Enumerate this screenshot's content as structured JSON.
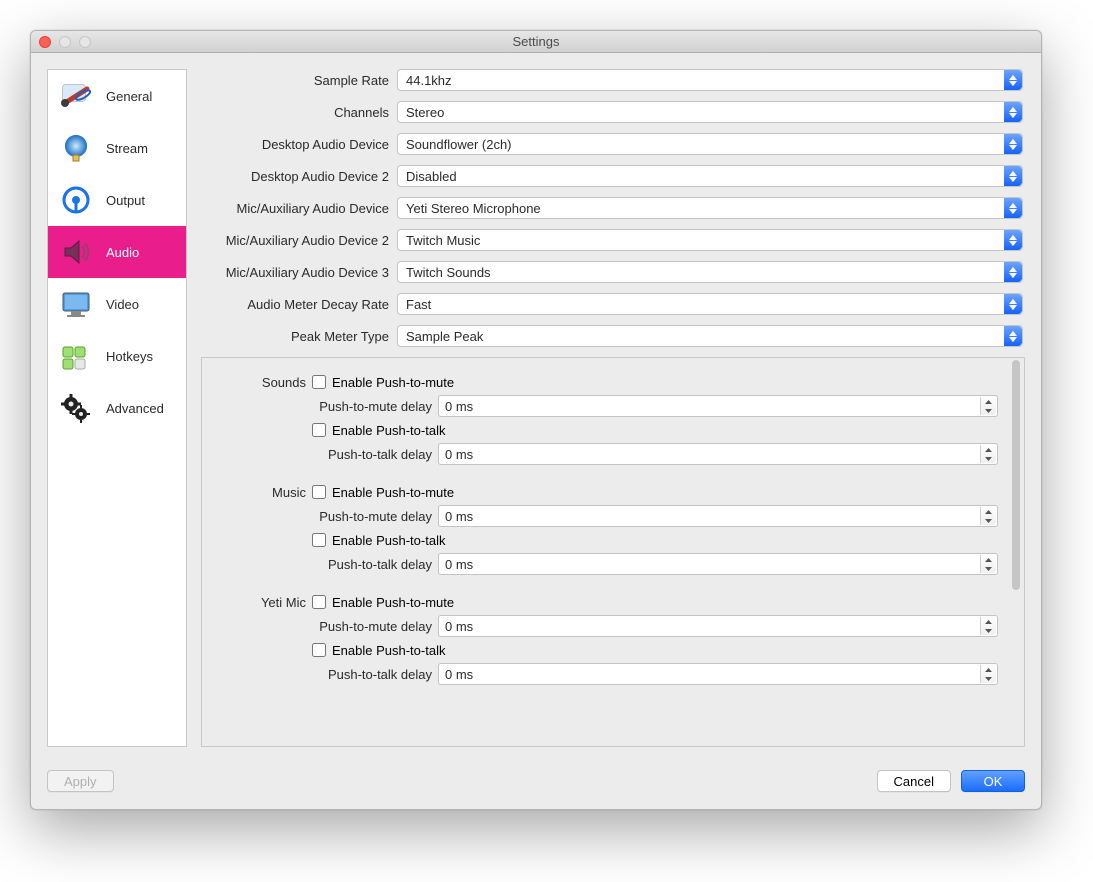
{
  "window": {
    "title": "Settings"
  },
  "sidebar": {
    "items": [
      {
        "label": "General"
      },
      {
        "label": "Stream"
      },
      {
        "label": "Output"
      },
      {
        "label": "Audio"
      },
      {
        "label": "Video"
      },
      {
        "label": "Hotkeys"
      },
      {
        "label": "Advanced"
      }
    ]
  },
  "fields": {
    "sample_rate": {
      "label": "Sample Rate",
      "value": "44.1khz"
    },
    "channels": {
      "label": "Channels",
      "value": "Stereo"
    },
    "desktop1": {
      "label": "Desktop Audio Device",
      "value": "Soundflower (2ch)"
    },
    "desktop2": {
      "label": "Desktop Audio Device 2",
      "value": "Disabled"
    },
    "mic1": {
      "label": "Mic/Auxiliary Audio Device",
      "value": "Yeti Stereo Microphone"
    },
    "mic2": {
      "label": "Mic/Auxiliary Audio Device 2",
      "value": "Twitch Music"
    },
    "mic3": {
      "label": "Mic/Auxiliary Audio Device 3",
      "value": "Twitch Sounds"
    },
    "decay": {
      "label": "Audio Meter Decay Rate",
      "value": "Fast"
    },
    "peak": {
      "label": "Peak Meter Type",
      "value": "Sample Peak"
    }
  },
  "sub_labels": {
    "enable_ptm": "Enable Push-to-mute",
    "enable_ptt": "Enable Push-to-talk",
    "ptm_delay": "Push-to-mute delay",
    "ptt_delay": "Push-to-talk delay"
  },
  "devices": [
    {
      "name": "Sounds",
      "ptm_delay": "0 ms",
      "ptt_delay": "0 ms"
    },
    {
      "name": "Music",
      "ptm_delay": "0 ms",
      "ptt_delay": "0 ms"
    },
    {
      "name": "Yeti Mic",
      "ptm_delay": "0 ms",
      "ptt_delay": "0 ms"
    }
  ],
  "buttons": {
    "apply": "Apply",
    "cancel": "Cancel",
    "ok": "OK"
  }
}
